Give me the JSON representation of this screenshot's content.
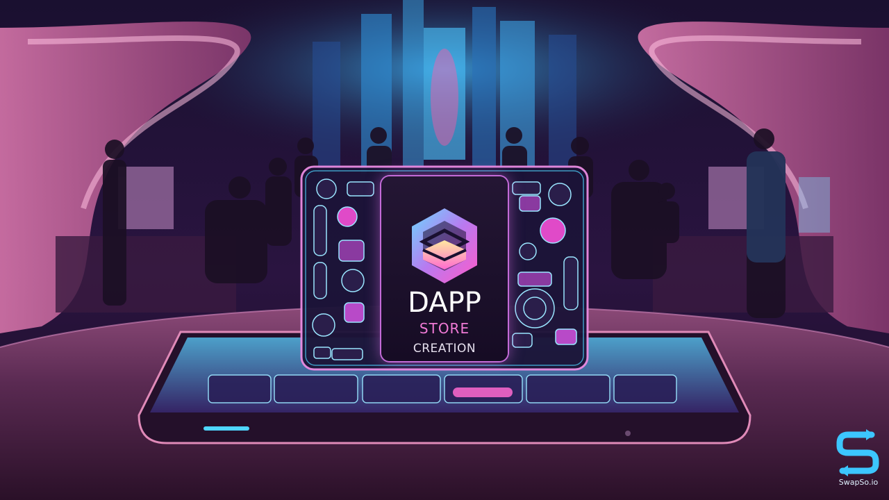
{
  "card": {
    "title": "DAPP",
    "subtitle_1": "STORE",
    "subtitle_2": "CREATION"
  },
  "brand": {
    "name": "SwapSo.io",
    "icon": "swap-s-arrows-icon"
  },
  "colors": {
    "accent_pink": "#f07ad6",
    "accent_cyan": "#4fd6ff",
    "background": "#120a1e"
  }
}
